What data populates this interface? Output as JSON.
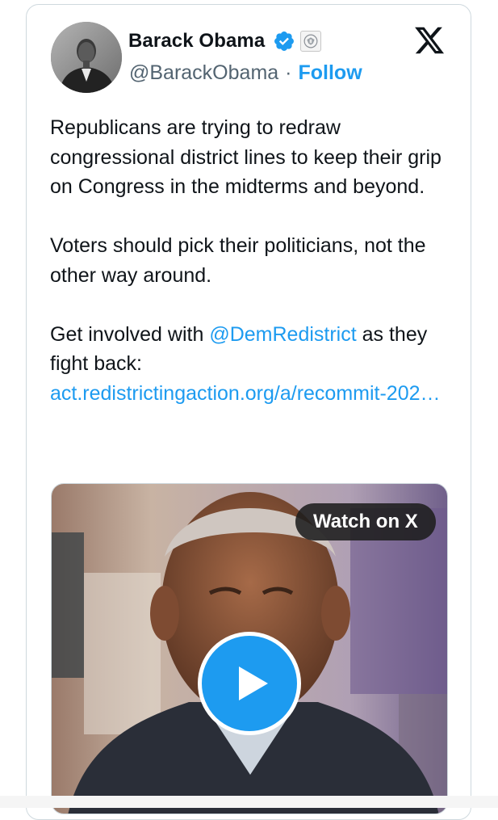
{
  "tweet": {
    "author_name": "Barack Obama",
    "handle": "@BarackObama",
    "separator": "·",
    "follow_label": "Follow",
    "paragraphs": [
      "Republicans are trying to redraw congressional district lines to keep their grip on Congress in the midterms and beyond.",
      "Voters should pick their politicians, not the other way around."
    ],
    "p3_prefix": "Get involved with ",
    "p3_mention": "@DemRedistrict",
    "p3_suffix": " as they fight back: ",
    "p3_link": "act.redistrictingaction.org/a/recommit-202…"
  },
  "media": {
    "watch_label": "Watch on X"
  },
  "icons": {
    "verified": "verified-badge-icon",
    "government": "government-seal-icon",
    "platform": "x-logo-icon",
    "play": "play-icon"
  },
  "colors": {
    "accent": "#1d9bf0",
    "text": "#0f1419",
    "muted": "#536471"
  }
}
